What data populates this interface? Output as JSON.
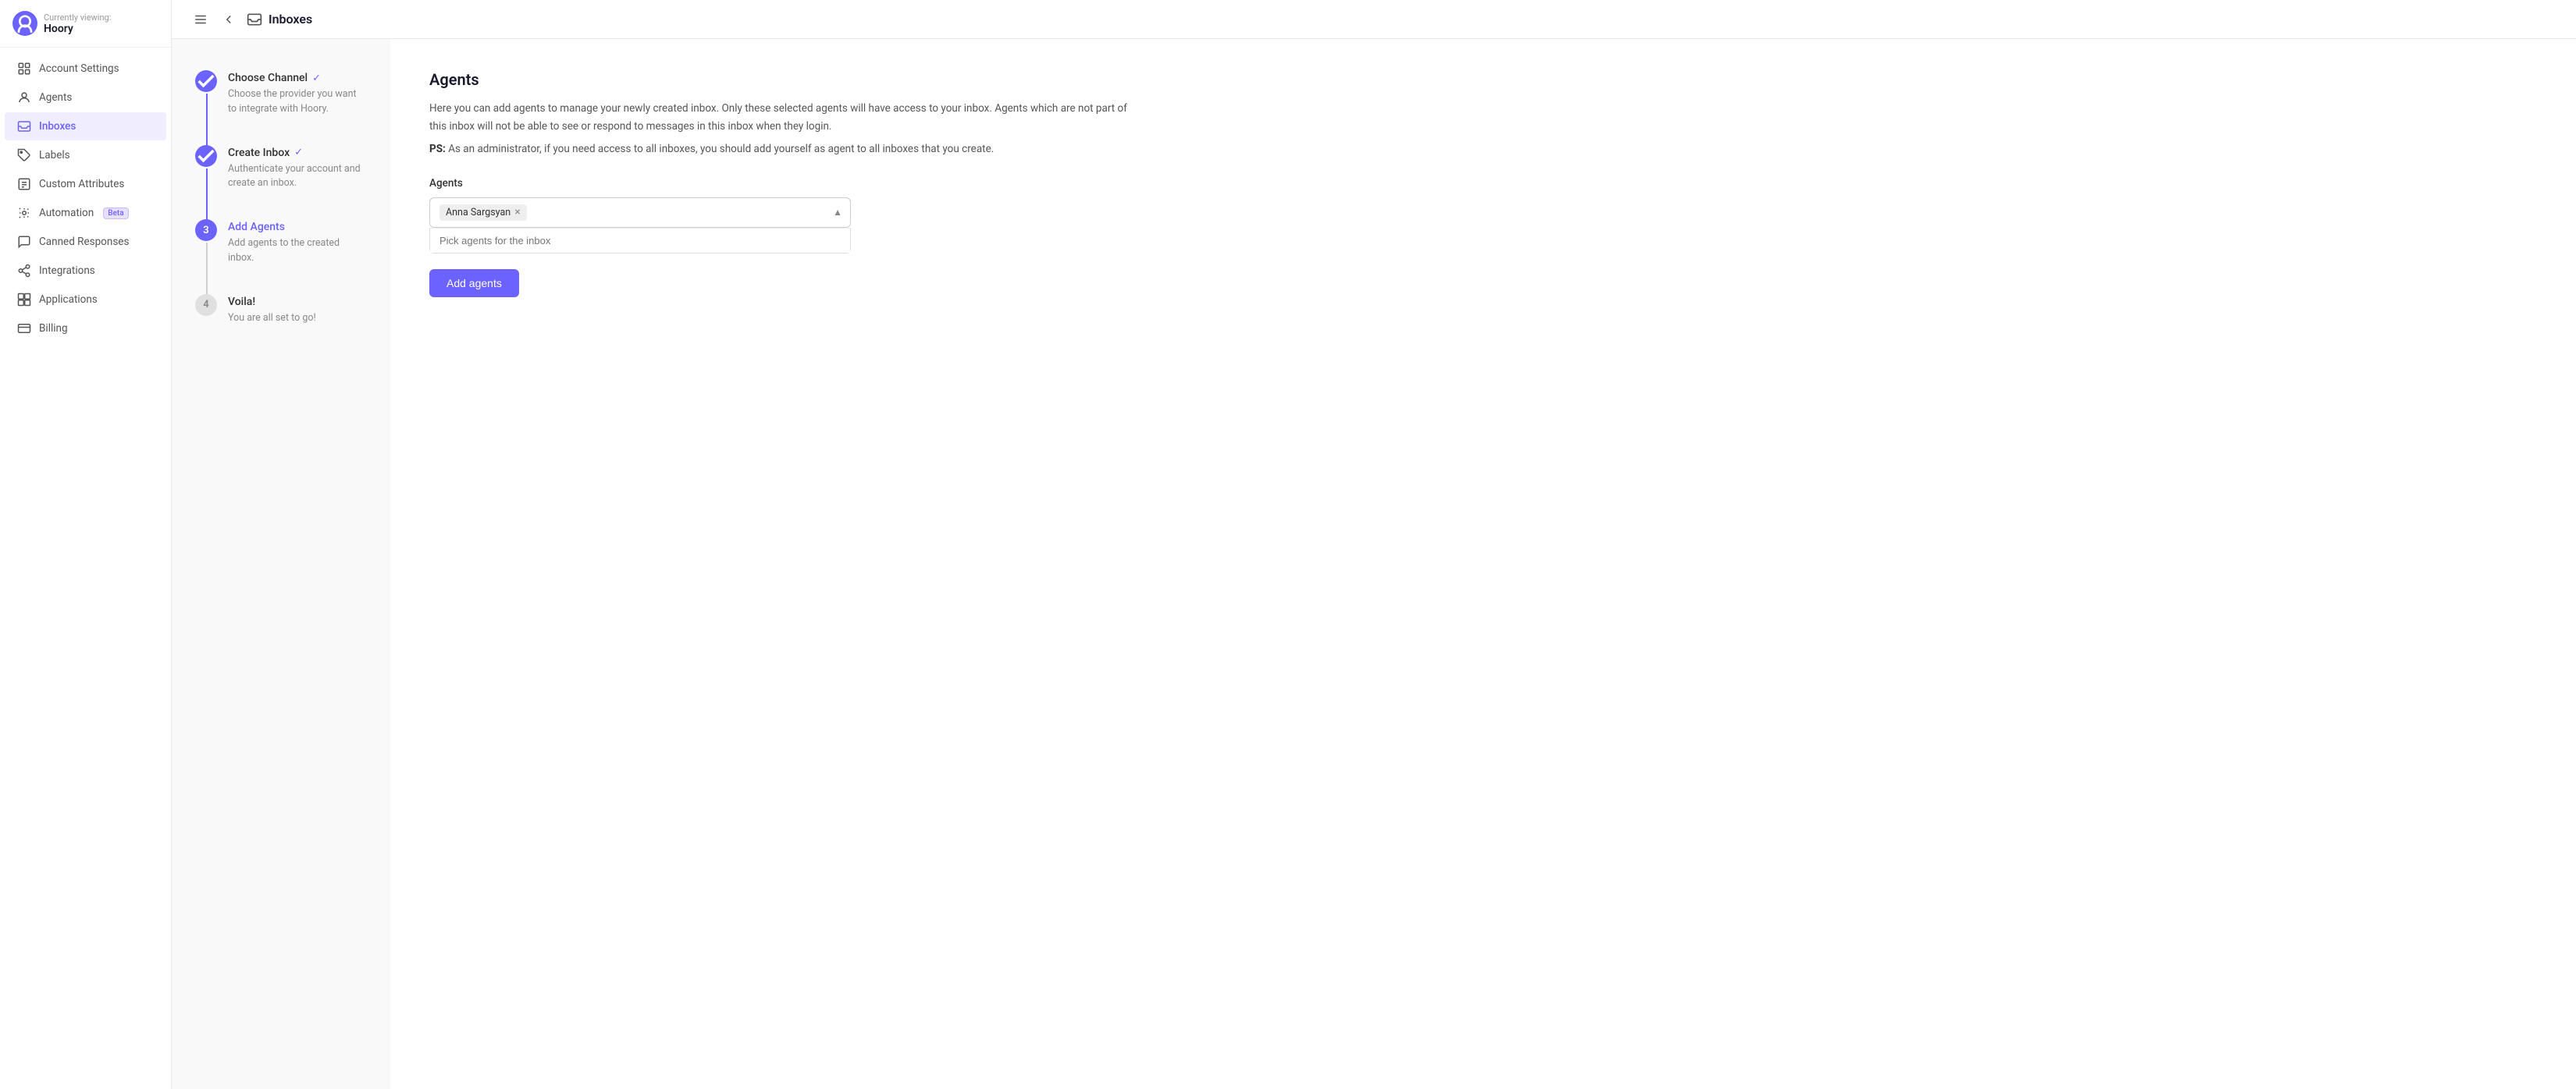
{
  "sidebar": {
    "viewing_label": "Currently viewing:",
    "account_name": "Hoory",
    "nav_items": [
      {
        "id": "account-settings",
        "label": "Account Settings",
        "icon": "settings-icon"
      },
      {
        "id": "agents",
        "label": "Agents",
        "icon": "agents-icon"
      },
      {
        "id": "inboxes",
        "label": "Inboxes",
        "icon": "inbox-icon",
        "active": true
      },
      {
        "id": "labels",
        "label": "Labels",
        "icon": "labels-icon"
      },
      {
        "id": "custom-attributes",
        "label": "Custom Attributes",
        "icon": "custom-attr-icon"
      },
      {
        "id": "automation",
        "label": "Automation",
        "icon": "automation-icon",
        "badge": "Beta"
      },
      {
        "id": "canned-responses",
        "label": "Canned Responses",
        "icon": "canned-icon"
      },
      {
        "id": "integrations",
        "label": "Integrations",
        "icon": "integrations-icon"
      },
      {
        "id": "applications",
        "label": "Applications",
        "icon": "applications-icon"
      },
      {
        "id": "billing",
        "label": "Billing",
        "icon": "billing-icon"
      }
    ]
  },
  "topbar": {
    "page_title": "Inboxes"
  },
  "steps": [
    {
      "number": "1",
      "state": "completed",
      "title": "Choose Channel",
      "check": true,
      "description": "Choose the provider you want to integrate with Hoory."
    },
    {
      "number": "2",
      "state": "completed",
      "title": "Create Inbox",
      "check": true,
      "description": "Authenticate your account and create an inbox."
    },
    {
      "number": "3",
      "state": "active",
      "title": "Add Agents",
      "check": false,
      "description": "Add agents to the created inbox."
    },
    {
      "number": "4",
      "state": "pending",
      "title": "Voila!",
      "check": false,
      "description": "You are all set to go!"
    }
  ],
  "form": {
    "heading": "Agents",
    "description": "Here you can add agents to manage your newly created inbox. Only these selected agents will have access to your inbox. Agents which are not part of this inbox will not be able to see or respond to messages in this inbox when they login.",
    "ps_prefix": "PS:",
    "ps_text": " As an administrator, if you need access to all inboxes, you should add yourself as agent to all inboxes that you create.",
    "field_label": "Agents",
    "selected_agents": [
      {
        "name": "Anna Sargsyan"
      }
    ],
    "search_placeholder": "Pick agents for the inbox",
    "add_button_label": "Add agents"
  }
}
